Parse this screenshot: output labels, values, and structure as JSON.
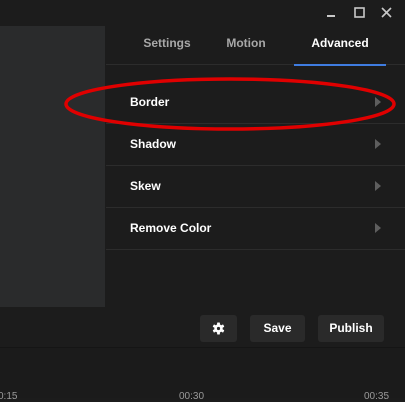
{
  "window_controls": {
    "minimize_icon": "minimize-icon",
    "maximize_icon": "maximize-icon",
    "close_icon": "close-icon"
  },
  "tabs": [
    {
      "label": "Settings",
      "active": false
    },
    {
      "label": "Motion",
      "active": false
    },
    {
      "label": "Advanced",
      "active": true
    }
  ],
  "advanced_items": [
    {
      "label": "Border"
    },
    {
      "label": "Shadow"
    },
    {
      "label": "Skew"
    },
    {
      "label": "Remove Color"
    }
  ],
  "actions": {
    "settings_icon": "gear-icon",
    "save_label": "Save",
    "publish_label": "Publish"
  },
  "timeline": {
    "ticks": [
      "0:15",
      "00:30",
      "00:35"
    ]
  },
  "colors": {
    "background": "#1c1c1c",
    "accent": "#3f7ce0",
    "annotation": "#e00000"
  }
}
